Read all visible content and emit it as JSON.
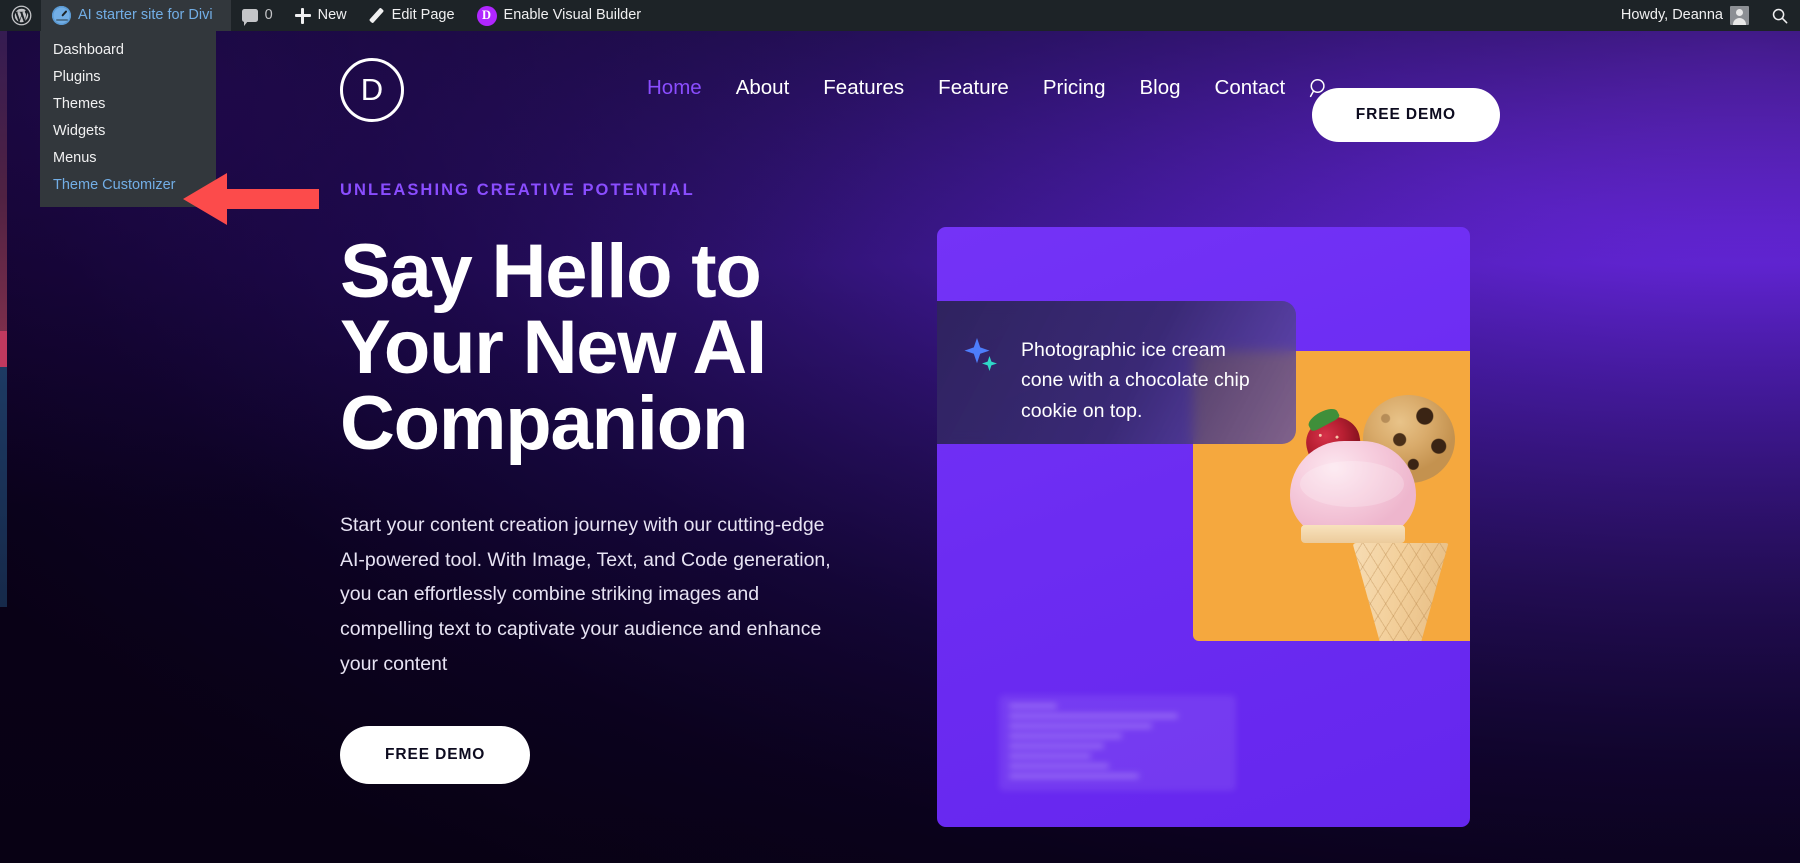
{
  "admin_bar": {
    "wp_logo": "wordpress-logo",
    "site_name": "AI starter site for Divi",
    "comments_count": "0",
    "new_label": "New",
    "edit_page_label": "Edit Page",
    "visual_builder_label": "Enable Visual Builder",
    "visual_builder_badge": "D",
    "howdy": "Howdy, Deanna"
  },
  "wp_dropdown": {
    "items": [
      {
        "label": "Dashboard",
        "active": false
      },
      {
        "label": "Plugins",
        "active": false
      },
      {
        "label": "Themes",
        "active": false
      },
      {
        "label": "Widgets",
        "active": false
      },
      {
        "label": "Menus",
        "active": false
      },
      {
        "label": "Theme Customizer",
        "active": true
      }
    ]
  },
  "annotation": {
    "arrow_color": "#fc4b4b",
    "points_to": "Theme Customizer"
  },
  "site_header": {
    "logo_letter": "D",
    "nav": [
      {
        "label": "Home",
        "active": true
      },
      {
        "label": "About",
        "active": false
      },
      {
        "label": "Features",
        "active": false
      },
      {
        "label": "Feature",
        "active": false
      },
      {
        "label": "Pricing",
        "active": false
      },
      {
        "label": "Blog",
        "active": false
      },
      {
        "label": "Contact",
        "active": false
      }
    ],
    "cta_label": "FREE DEMO"
  },
  "hero": {
    "eyebrow": "UNLEASHING CREATIVE POTENTIAL",
    "title_line_1": "Say Hello to",
    "title_line_2": "Your New AI",
    "title_line_3": "Companion",
    "paragraph": "Start your content creation journey with our cutting-edge AI-powered tool. With Image, Text, and Code generation, you can effortlessly combine striking images and compelling text to captivate your audience and enhance your content",
    "cta_label": "FREE DEMO",
    "prompt_text": "Photographic ice cream cone with a chocolate chip cookie on top."
  },
  "colors": {
    "accent_purple": "#8a4dff",
    "card_purple": "#6c2cf2",
    "photo_orange": "#f5a83e",
    "admin_bar": "#1d2327",
    "admin_menu": "#32373c",
    "link_blue": "#72aee6",
    "arrow_red": "#fc4b4b"
  }
}
